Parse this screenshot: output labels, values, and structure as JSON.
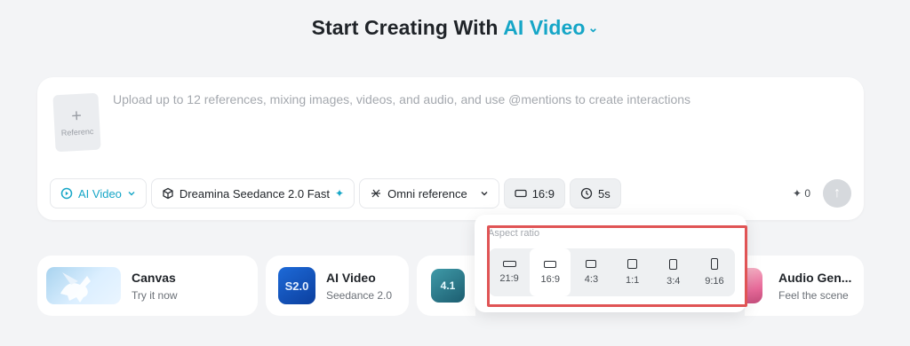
{
  "headline": {
    "prefix": "Start Creating With",
    "accent": "AI Video"
  },
  "composer": {
    "reference_label": "Referenc",
    "placeholder": "Upload up to 12 references, mixing images, videos, and audio, and use @mentions to create interactions",
    "toolbar": {
      "mode": "AI Video",
      "model": "Dreamina Seedance 2.0 Fast",
      "reference": "Omni reference",
      "aspect": "16:9",
      "duration": "5s"
    },
    "credits": "0"
  },
  "cards": [
    {
      "title": "Canvas",
      "subtitle": "Try it now"
    },
    {
      "title": "AI Video",
      "subtitle": "Seedance 2.0",
      "thumb_text": "S2.0"
    },
    {
      "title": "",
      "subtitle": "",
      "thumb_text": "4.1"
    },
    {
      "title": "Audio Gen...",
      "subtitle": "Feel the scene"
    }
  ],
  "aspect_popover": {
    "title": "Aspect ratio",
    "selected": "16:9",
    "options": [
      "21:9",
      "16:9",
      "4:3",
      "1:1",
      "3:4",
      "9:16"
    ]
  },
  "colors": {
    "accent": "#16a6c7",
    "highlight": "#e05455"
  }
}
